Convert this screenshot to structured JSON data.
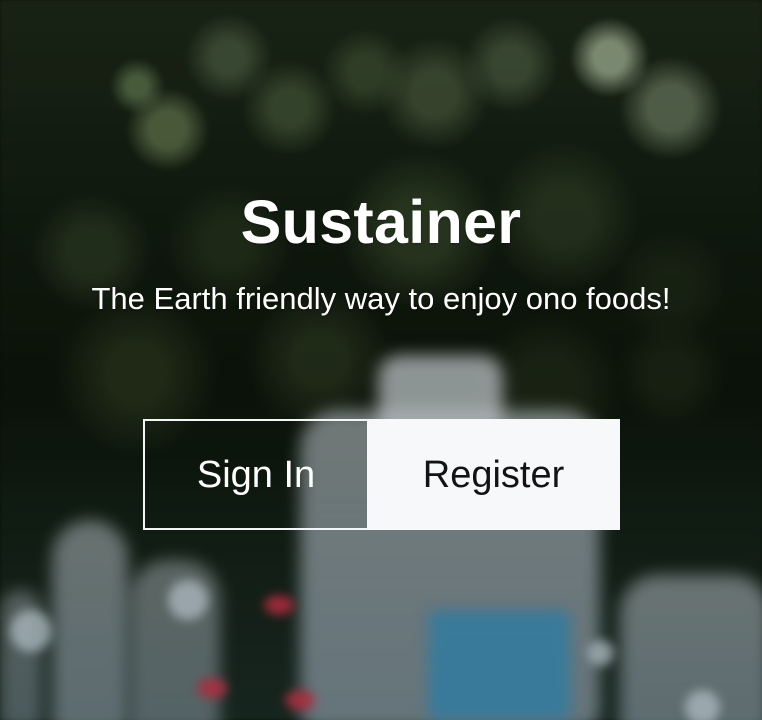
{
  "hero": {
    "title": "Sustainer",
    "subtitle": "The Earth friendly way to enjoy ono foods!",
    "background_image": "blurred-recycled-plastic-bottles-in-front-of-green-foliage"
  },
  "actions": {
    "sign_in_label": "Sign In",
    "register_label": "Register"
  },
  "colors": {
    "text_primary": "#ffffff",
    "button_register_background": "#f7f8fa",
    "button_register_text": "#131313",
    "button_sign_in_border": "#f4f5f7"
  }
}
